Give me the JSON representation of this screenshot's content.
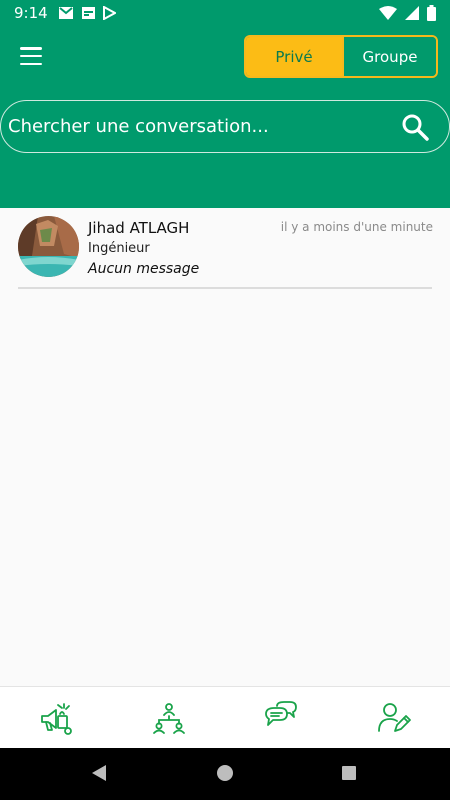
{
  "status_bar": {
    "time": "9:14",
    "left_icons": [
      "gmail-icon",
      "calendar-icon",
      "play-store-icon"
    ],
    "right_icons": [
      "wifi-icon",
      "signal-icon",
      "battery-icon"
    ]
  },
  "header": {
    "menu_icon": "hamburger-menu-icon",
    "segments": [
      {
        "label": "Privé",
        "selected": true
      },
      {
        "label": "Groupe",
        "selected": false
      }
    ],
    "search": {
      "placeholder": "Chercher une conversation...",
      "icon": "search-icon"
    }
  },
  "conversations": [
    {
      "name": "Jihad ATLAGH",
      "role": "Ingénieur",
      "last_message": "Aucun message",
      "time": "il y a moins d'une minute"
    }
  ],
  "bottom_nav": [
    {
      "icon": "marketing-icon"
    },
    {
      "icon": "network-icon"
    },
    {
      "icon": "chat-icon",
      "active": true
    },
    {
      "icon": "edit-profile-icon"
    }
  ],
  "colors": {
    "primary": "#009a6c",
    "accent": "#fcbc15",
    "nav_icon": "#1aa34a"
  }
}
